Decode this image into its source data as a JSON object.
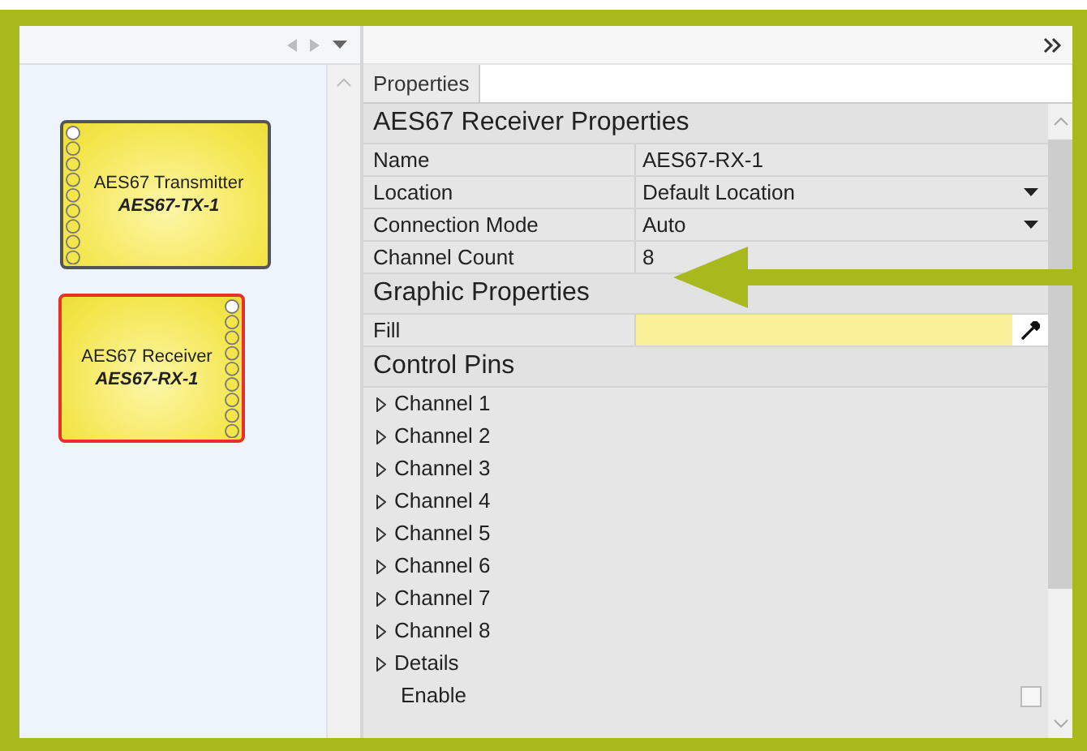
{
  "canvas": {
    "blocks": [
      {
        "kind": "transmitter",
        "title": "AES67 Transmitter",
        "name": "AES67-TX-1",
        "selected": false
      },
      {
        "kind": "receiver",
        "title": "AES67 Receiver",
        "name": "AES67-RX-1",
        "selected": true
      }
    ]
  },
  "tabs": [
    {
      "label": "Properties",
      "selected": true
    }
  ],
  "sections": [
    {
      "title": "AES67 Receiver Properties",
      "rows": [
        {
          "kind": "text",
          "label": "Name",
          "value": "AES67-RX-1"
        },
        {
          "kind": "dropdown",
          "label": "Location",
          "value": "Default Location"
        },
        {
          "kind": "dropdown",
          "label": "Connection Mode",
          "value": "Auto"
        },
        {
          "kind": "text",
          "label": "Channel Count",
          "value": "8"
        }
      ]
    },
    {
      "title": "Graphic Properties",
      "rows": [
        {
          "kind": "color",
          "label": "Fill",
          "color": "#faf09a"
        }
      ]
    },
    {
      "title": "Control Pins",
      "rows": [
        {
          "kind": "node",
          "label": "Channel 1",
          "expanded": false
        },
        {
          "kind": "node",
          "label": "Channel 2",
          "expanded": false
        },
        {
          "kind": "node",
          "label": "Channel 3",
          "expanded": false
        },
        {
          "kind": "node",
          "label": "Channel 4",
          "expanded": false
        },
        {
          "kind": "node",
          "label": "Channel 5",
          "expanded": false
        },
        {
          "kind": "node",
          "label": "Channel 6",
          "expanded": false
        },
        {
          "kind": "node",
          "label": "Channel 7",
          "expanded": false
        },
        {
          "kind": "node",
          "label": "Channel 8",
          "expanded": false
        },
        {
          "kind": "node",
          "label": "Details",
          "expanded": false
        },
        {
          "kind": "check",
          "label": "Enable",
          "checked": false
        }
      ]
    }
  ]
}
